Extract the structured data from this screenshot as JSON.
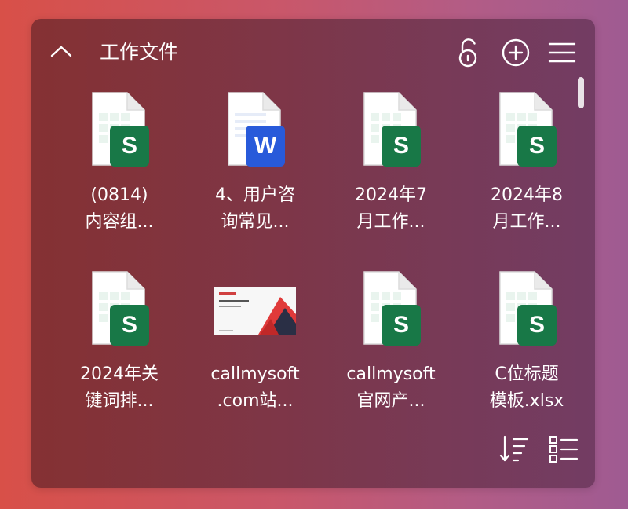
{
  "header": {
    "title": "工作文件"
  },
  "files": [
    {
      "type": "excel",
      "badge": "S",
      "line1": "(0814)",
      "line2": "内容组..."
    },
    {
      "type": "word",
      "badge": "W",
      "line1": "4、用户咨",
      "line2": "询常见..."
    },
    {
      "type": "excel",
      "badge": "S",
      "line1": "2024年7",
      "line2": "月工作..."
    },
    {
      "type": "excel",
      "badge": "S",
      "line1": "2024年8",
      "line2": "月工作..."
    },
    {
      "type": "excel",
      "badge": "S",
      "line1": "2024年关",
      "line2": "键词排..."
    },
    {
      "type": "image",
      "badge": "",
      "line1": "callmysoft",
      "line2": ".com站..."
    },
    {
      "type": "excel",
      "badge": "S",
      "line1": "callmysoft",
      "line2": "官网产..."
    },
    {
      "type": "excel",
      "badge": "S",
      "line1": "C位标题",
      "line2": "模板.xlsx"
    }
  ],
  "colors": {
    "excel_badge": "#1a7f4b",
    "word_badge": "#2b5fe6"
  }
}
